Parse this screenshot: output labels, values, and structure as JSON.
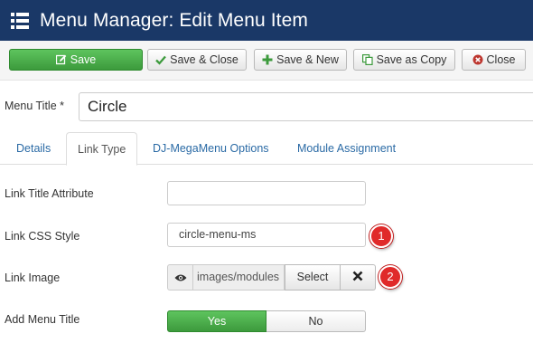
{
  "header": {
    "title": "Menu Manager: Edit Menu Item",
    "menu_icon": "list-menu-icon",
    "background_color": "#1a3867"
  },
  "toolbar": {
    "save_label": "Save",
    "save_close_label": "Save & Close",
    "save_new_label": "Save & New",
    "save_copy_label": "Save as Copy",
    "close_label": "Close",
    "save_color": "#46a546"
  },
  "form": {
    "menu_title_label": "Menu Title *",
    "menu_title_value": "Circle"
  },
  "tabs": [
    {
      "label": "Details"
    },
    {
      "label": "Link Type",
      "active": true
    },
    {
      "label": "DJ-MegaMenu Options"
    },
    {
      "label": "Module Assignment"
    }
  ],
  "fields": {
    "link_title_label": "Link Title Attribute",
    "link_title_value": "",
    "link_css_label": "Link CSS Style",
    "link_css_value": "circle-menu-ms",
    "link_image_label": "Link Image",
    "link_image_value": "images/modules",
    "link_image_select": "Select",
    "add_menu_title_label": "Add Menu Title",
    "toggle_yes": "Yes",
    "toggle_no": "No"
  },
  "annotations": [
    {
      "number": "1"
    },
    {
      "number": "2"
    }
  ],
  "annotation_color": "#e02a2a"
}
